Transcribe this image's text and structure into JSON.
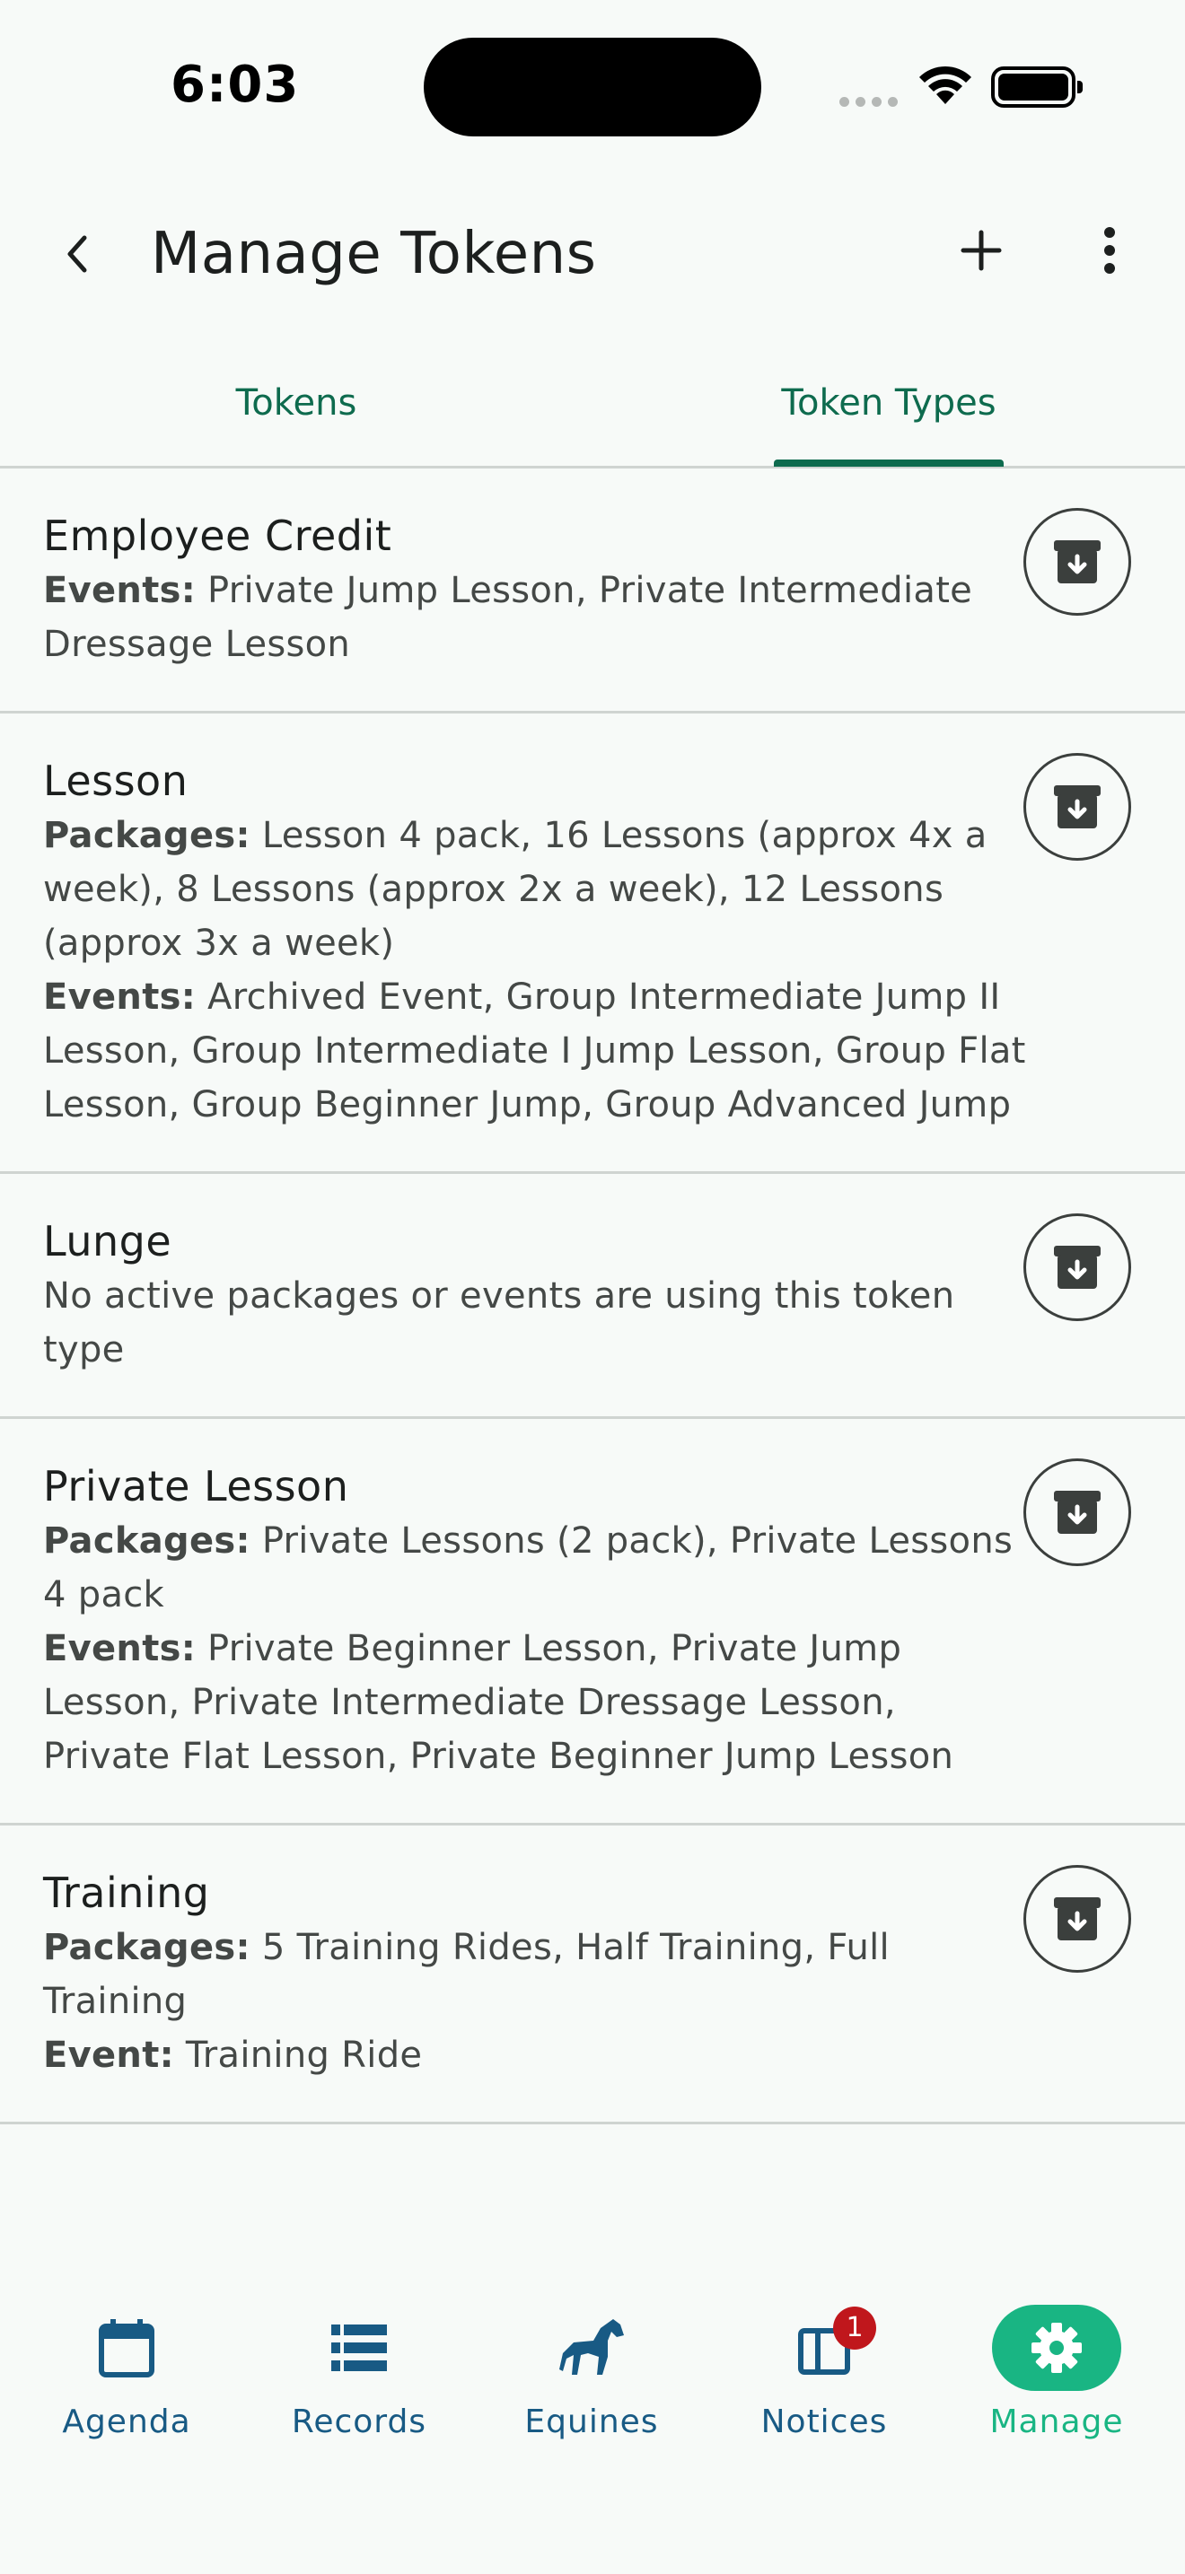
{
  "status_bar": {
    "time": "6:03"
  },
  "app_bar": {
    "title": "Manage Tokens"
  },
  "tabs": [
    {
      "label": "Tokens",
      "selected": false
    },
    {
      "label": "Token Types",
      "selected": true
    }
  ],
  "token_types": [
    {
      "name": "Employee Credit",
      "lines": [
        {
          "label": "Events:",
          "text": " Private Jump Lesson, Private Intermediate Dressage Lesson"
        }
      ]
    },
    {
      "name": "Lesson",
      "lines": [
        {
          "label": "Packages:",
          "text": " Lesson 4 pack, 16 Lessons (approx 4x a week), 8 Lessons (approx 2x a week), 12 Lessons (approx 3x a week)"
        },
        {
          "label": "Events:",
          "text": " Archived Event, Group Intermediate Jump II Lesson, Group Intermediate I Jump Lesson, Group Flat Lesson, Group Beginner Jump, Group Advanced Jump"
        }
      ]
    },
    {
      "name": "Lunge",
      "lines": [
        {
          "label": "",
          "text": "No active packages or events are using this token type"
        }
      ]
    },
    {
      "name": "Private Lesson",
      "lines": [
        {
          "label": "Packages:",
          "text": " Private Lessons (2 pack), Private Lessons 4 pack"
        },
        {
          "label": "Events:",
          "text": " Private Beginner Lesson, Private Jump Lesson, Private Intermediate Dressage Lesson, Private Flat Lesson, Private Beginner Jump Lesson"
        }
      ]
    },
    {
      "name": "Training",
      "lines": [
        {
          "label": "Packages:",
          "text": " 5 Training Rides, Half Training, Full Training"
        },
        {
          "label": "Event:",
          "text": " Training Ride"
        }
      ]
    }
  ],
  "bottom_nav": [
    {
      "label": "Agenda",
      "icon": "calendar-icon",
      "active": false
    },
    {
      "label": "Records",
      "icon": "list-icon",
      "active": false
    },
    {
      "label": "Equines",
      "icon": "horse-icon",
      "active": false
    },
    {
      "label": "Notices",
      "icon": "notice-icon",
      "active": false,
      "badge": "1"
    },
    {
      "label": "Manage",
      "icon": "gear-icon",
      "active": true
    }
  ],
  "colors": {
    "accent": "#0e6b4e",
    "active_nav": "#19b583",
    "nav_text": "#185a84",
    "badge": "#c0171c"
  }
}
